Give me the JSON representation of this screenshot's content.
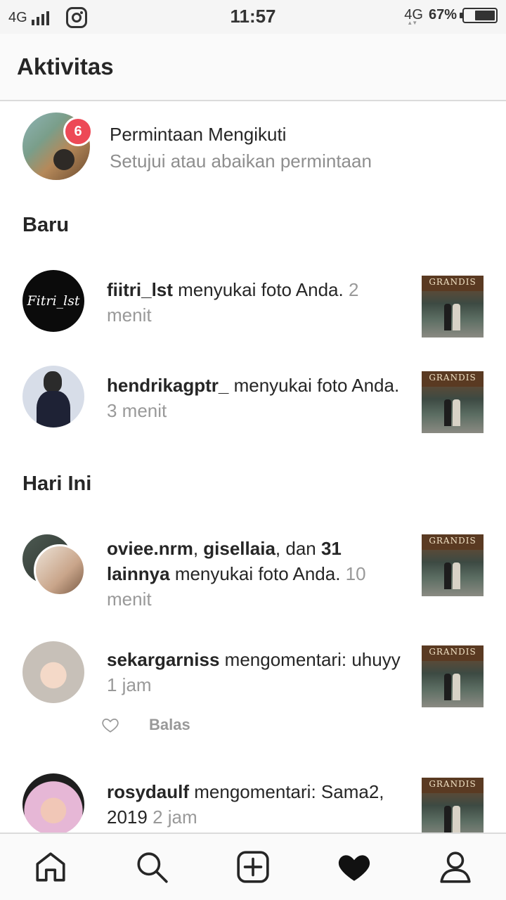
{
  "status_bar": {
    "network_left": "4G",
    "time": "11:57",
    "network_right": "4G",
    "battery": "67%",
    "battery_level": 0.67
  },
  "header": {
    "title": "Aktivitas"
  },
  "follow_requests": {
    "count": "6",
    "title": "Permintaan Mengikuti",
    "subtitle": "Setujui atau abaikan permintaan"
  },
  "sections": {
    "new": "Baru",
    "today": "Hari Ini"
  },
  "notifications": [
    {
      "user": "fiitri_lst",
      "avatar_text": "Fitri_lst",
      "action": " menyukai foto Anda.",
      "time": " 2 menit"
    },
    {
      "user": "hendrikagptr_",
      "action": " menyukai foto Anda.",
      "time": " 3 menit"
    },
    {
      "user": "oviee.nrm",
      "sep1": ", ",
      "user2": "gisellaia",
      "sep2": ", dan ",
      "others": "31 lainnya",
      "action": " menyukai foto Anda.",
      "time": " 10 menit"
    },
    {
      "user": "sekargarniss",
      "action": " mengomentari: uhuyy",
      "time": " 1 jam",
      "reply_label": "Balas"
    },
    {
      "user": "rosydaulf",
      "action": " mengomentari: Sama2, 2019",
      "time": " 2 jam"
    }
  ],
  "thumb_sign": "GRANDIS",
  "icons": {
    "nav": [
      "home-icon",
      "search-icon",
      "add-post-icon",
      "activity-heart-icon",
      "profile-icon"
    ]
  }
}
